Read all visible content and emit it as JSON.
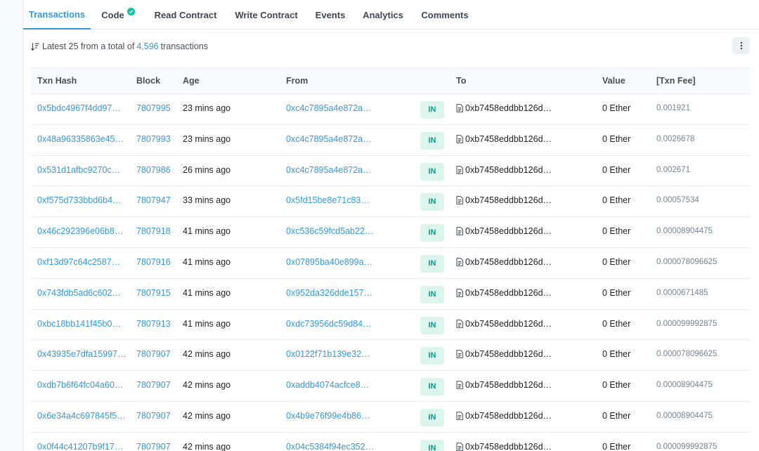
{
  "tabs": [
    {
      "label": "Transactions",
      "active": true
    },
    {
      "label": "Code",
      "verified": true
    },
    {
      "label": "Read Contract"
    },
    {
      "label": "Write Contract"
    },
    {
      "label": "Events"
    },
    {
      "label": "Analytics"
    },
    {
      "label": "Comments"
    }
  ],
  "summary": {
    "prefix": "Latest 25 from a total of",
    "count": "4,596",
    "suffix": "transactions",
    "sort_icon": "sort-desc-icon",
    "more_icon": "more-vertical-icon"
  },
  "columns": [
    "Txn Hash",
    "Block",
    "Age",
    "From",
    "To",
    "Value",
    "[Txn Fee]"
  ],
  "colors": {
    "link": "#3498db",
    "in_badge_bg": "#dcf5ec",
    "in_badge_text": "#00a186",
    "verified": "#00c9a7"
  },
  "rows": [
    {
      "hash": "0x5bdc4967f4dd97…",
      "block": "7807995",
      "age": "23 mins ago",
      "from": "0xc4c7895a4e872a…",
      "dir": "IN",
      "to": "0xb7458eddbb126d…",
      "value": "0 Ether",
      "fee": "0.001921"
    },
    {
      "hash": "0x48a96335863e45…",
      "block": "7807993",
      "age": "23 mins ago",
      "from": "0xc4c7895a4e872a…",
      "dir": "IN",
      "to": "0xb7458eddbb126d…",
      "value": "0 Ether",
      "fee": "0.0026678"
    },
    {
      "hash": "0x531d1afbc9270c…",
      "block": "7807986",
      "age": "26 mins ago",
      "from": "0xc4c7895a4e872a…",
      "dir": "IN",
      "to": "0xb7458eddbb126d…",
      "value": "0 Ether",
      "fee": "0.002671"
    },
    {
      "hash": "0xf575d733bbd6b4…",
      "block": "7807947",
      "age": "33 mins ago",
      "from": "0x5fd15be8e71c83…",
      "dir": "IN",
      "to": "0xb7458eddbb126d…",
      "value": "0 Ether",
      "fee": "0.00057534"
    },
    {
      "hash": "0x46c292396e06b8…",
      "block": "7807918",
      "age": "41 mins ago",
      "from": "0xc536c59fcd5ab22…",
      "dir": "IN",
      "to": "0xb7458eddbb126d…",
      "value": "0 Ether",
      "fee": "0.00008904475"
    },
    {
      "hash": "0xf13d97c64c2587…",
      "block": "7807916",
      "age": "41 mins ago",
      "from": "0x07895ba40e899a…",
      "dir": "IN",
      "to": "0xb7458eddbb126d…",
      "value": "0 Ether",
      "fee": "0.000078096625"
    },
    {
      "hash": "0x743fdb5ad6c602…",
      "block": "7807915",
      "age": "41 mins ago",
      "from": "0x952da326dde157…",
      "dir": "IN",
      "to": "0xb7458eddbb126d…",
      "value": "0 Ether",
      "fee": "0.0000671485"
    },
    {
      "hash": "0xbc18bb141f45b0…",
      "block": "7807913",
      "age": "41 mins ago",
      "from": "0xdc73956dc59d84…",
      "dir": "IN",
      "to": "0xb7458eddbb126d…",
      "value": "0 Ether",
      "fee": "0.000099992875"
    },
    {
      "hash": "0x43935e7dfa15997…",
      "block": "7807907",
      "age": "42 mins ago",
      "from": "0x0122f71b139e32…",
      "dir": "IN",
      "to": "0xb7458eddbb126d…",
      "value": "0 Ether",
      "fee": "0.000078096625"
    },
    {
      "hash": "0xdb7b6f64fc04a60…",
      "block": "7807907",
      "age": "42 mins ago",
      "from": "0xaddb4074acfce8…",
      "dir": "IN",
      "to": "0xb7458eddbb126d…",
      "value": "0 Ether",
      "fee": "0.00008904475"
    },
    {
      "hash": "0x6e34a4c697845f5…",
      "block": "7807907",
      "age": "42 mins ago",
      "from": "0x4b9e76f99e4b86…",
      "dir": "IN",
      "to": "0xb7458eddbb126d…",
      "value": "0 Ether",
      "fee": "0.00008904475"
    },
    {
      "hash": "0x0f44c41207b9f17…",
      "block": "7807907",
      "age": "42 mins ago",
      "from": "0x04c5384f94ec352…",
      "dir": "IN",
      "to": "0xb7458eddbb126d…",
      "value": "0 Ether",
      "fee": "0.000099992875"
    }
  ]
}
